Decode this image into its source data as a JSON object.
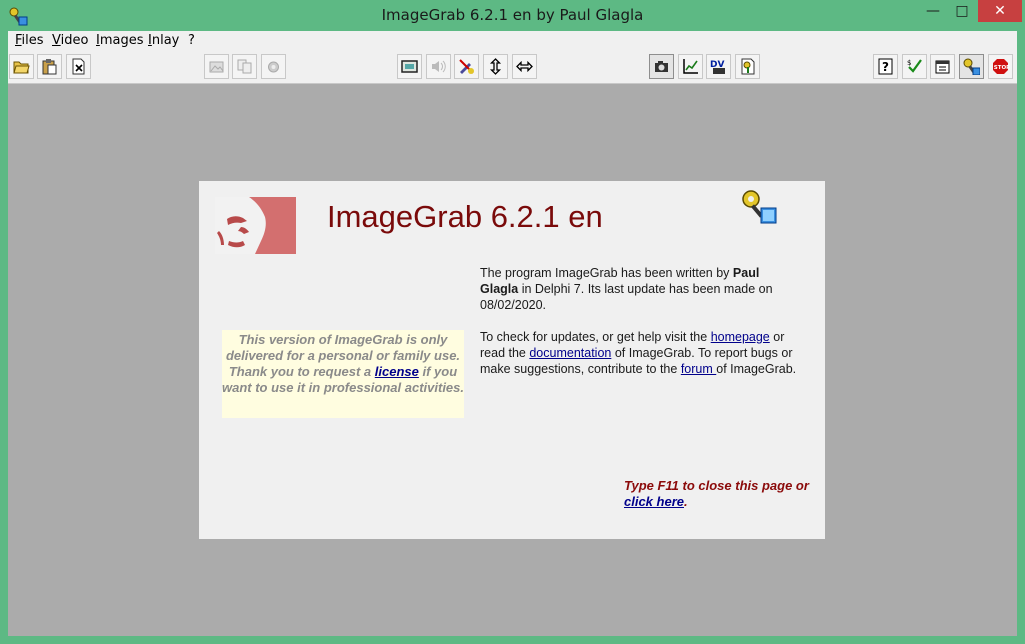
{
  "window": {
    "title": "ImageGrab 6.2.1 en by Paul Glagla",
    "minimize": "—",
    "maximize": "□",
    "close": "✕"
  },
  "menu": [
    {
      "label": "Files",
      "accel": "F",
      "rest": "iles"
    },
    {
      "label": "Video",
      "accel": "V",
      "rest": "ideo"
    },
    {
      "label": "Images",
      "accel": "I",
      "rest": "mages"
    },
    {
      "label": "Inlay",
      "accel": "I",
      "rest": "nlay"
    },
    {
      "label": "?",
      "accel": "",
      "rest": "?"
    }
  ],
  "toolbar": {
    "icons": [
      "open-folder-icon",
      "paste-icon",
      "close-document-icon",
      "disabled-image-icon",
      "copy-icon",
      "settings-icon",
      "fullscreen-icon",
      "sound-icon",
      "no-draw-icon",
      "vertical-resize-icon",
      "horizontal-resize-icon",
      "camera-icon",
      "chart-icon",
      "dvd-icon",
      "key-document-icon",
      "help-icon",
      "check-icon",
      "properties-icon",
      "key-icon",
      "stop-icon"
    ]
  },
  "about": {
    "heading": "ImageGrab 6.2.1 en",
    "notice": {
      "before": "This version of ImageGrab is only delivered for a personal or family use. Thank you to request a ",
      "link": "license",
      "after": " if you want to use it in professional activities."
    },
    "para1": {
      "a": "The program ImageGrab has been written by ",
      "author": "Paul Glagla",
      "b": " in Delphi 7.  Its last update has been made on 08/02/2020."
    },
    "para2": {
      "a": "To check for updates, or get help visit the ",
      "link1": "homepage",
      "b": " or read the ",
      "link2": "documentation",
      "c": " of ImageGrab. To report bugs or make suggestions, contribute to the ",
      "link3": "forum ",
      "d": "of ImageGrab."
    },
    "close_hint": {
      "text": "Type F11 to close this page or",
      "link": "click here",
      "end": "."
    }
  },
  "colors": {
    "titlebar": "#5db984",
    "client": "#ababab",
    "heading": "#7a0a0a",
    "link": "#00008b",
    "close_button": "#c74040"
  }
}
